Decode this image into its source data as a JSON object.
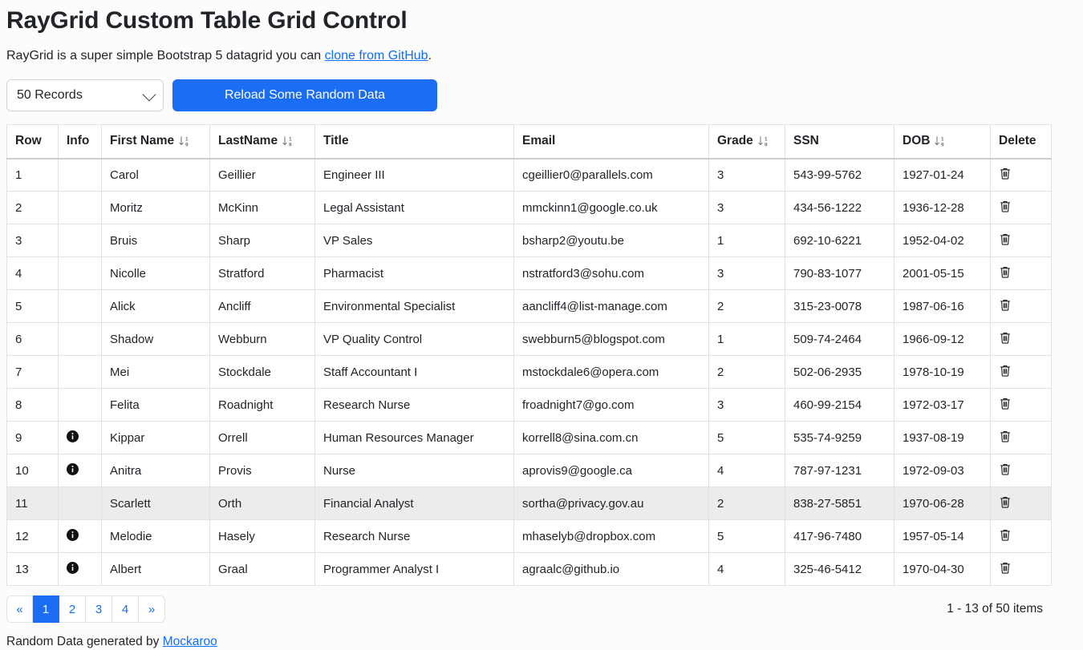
{
  "header": {
    "title": "RayGrid Custom Table Grid Control",
    "lead_prefix": "RayGrid is a super simple Bootstrap 5 datagrid you can ",
    "lead_link": "clone from GitHub",
    "lead_suffix": "."
  },
  "controls": {
    "records_select_value": "50 Records",
    "records_select_options": [
      "50 Records"
    ],
    "chevron_icon": "chevron-down-icon",
    "reload_button_label": "Reload Some Random Data",
    "primary_color": "#1b6ef3"
  },
  "table": {
    "columns": [
      {
        "key": "row",
        "label": "Row",
        "sortable": false
      },
      {
        "key": "info",
        "label": "Info",
        "sortable": false
      },
      {
        "key": "first",
        "label": "First Name",
        "sortable": true
      },
      {
        "key": "last",
        "label": "LastName",
        "sortable": true
      },
      {
        "key": "title",
        "label": "Title",
        "sortable": false
      },
      {
        "key": "email",
        "label": "Email",
        "sortable": false
      },
      {
        "key": "grade",
        "label": "Grade",
        "sortable": true
      },
      {
        "key": "ssn",
        "label": "SSN",
        "sortable": false
      },
      {
        "key": "dob",
        "label": "DOB",
        "sortable": true
      },
      {
        "key": "del",
        "label": "Delete",
        "sortable": false
      }
    ],
    "sort_icon": "sort-numeric-down-icon",
    "info_icon": "info-circle-fill-icon",
    "delete_icon": "trash-icon",
    "hovered_row_index": 10,
    "rows": [
      {
        "row": "1",
        "info": false,
        "first": "Carol",
        "last": "Geillier",
        "title": "Engineer III",
        "email": "cgeillier0@parallels.com",
        "grade": "3",
        "ssn": "543-99-5762",
        "dob": "1927-01-24"
      },
      {
        "row": "2",
        "info": false,
        "first": "Moritz",
        "last": "McKinn",
        "title": "Legal Assistant",
        "email": "mmckinn1@google.co.uk",
        "grade": "3",
        "ssn": "434-56-1222",
        "dob": "1936-12-28"
      },
      {
        "row": "3",
        "info": false,
        "first": "Bruis",
        "last": "Sharp",
        "title": "VP Sales",
        "email": "bsharp2@youtu.be",
        "grade": "1",
        "ssn": "692-10-6221",
        "dob": "1952-04-02"
      },
      {
        "row": "4",
        "info": false,
        "first": "Nicolle",
        "last": "Stratford",
        "title": "Pharmacist",
        "email": "nstratford3@sohu.com",
        "grade": "3",
        "ssn": "790-83-1077",
        "dob": "2001-05-15"
      },
      {
        "row": "5",
        "info": false,
        "first": "Alick",
        "last": "Ancliff",
        "title": "Environmental Specialist",
        "email": "aancliff4@list-manage.com",
        "grade": "2",
        "ssn": "315-23-0078",
        "dob": "1987-06-16"
      },
      {
        "row": "6",
        "info": false,
        "first": "Shadow",
        "last": "Webburn",
        "title": "VP Quality Control",
        "email": "swebburn5@blogspot.com",
        "grade": "1",
        "ssn": "509-74-2464",
        "dob": "1966-09-12"
      },
      {
        "row": "7",
        "info": false,
        "first": "Mei",
        "last": "Stockdale",
        "title": "Staff Accountant I",
        "email": "mstockdale6@opera.com",
        "grade": "2",
        "ssn": "502-06-2935",
        "dob": "1978-10-19"
      },
      {
        "row": "8",
        "info": false,
        "first": "Felita",
        "last": "Roadnight",
        "title": "Research Nurse",
        "email": "froadnight7@go.com",
        "grade": "3",
        "ssn": "460-99-2154",
        "dob": "1972-03-17"
      },
      {
        "row": "9",
        "info": true,
        "first": "Kippar",
        "last": "Orrell",
        "title": "Human Resources Manager",
        "email": "korrell8@sina.com.cn",
        "grade": "5",
        "ssn": "535-74-9259",
        "dob": "1937-08-19"
      },
      {
        "row": "10",
        "info": true,
        "first": "Anitra",
        "last": "Provis",
        "title": "Nurse",
        "email": "aprovis9@google.ca",
        "grade": "4",
        "ssn": "787-97-1231",
        "dob": "1972-09-03"
      },
      {
        "row": "11",
        "info": false,
        "first": "Scarlett",
        "last": "Orth",
        "title": "Financial Analyst",
        "email": "sortha@privacy.gov.au",
        "grade": "2",
        "ssn": "838-27-5851",
        "dob": "1970-06-28"
      },
      {
        "row": "12",
        "info": true,
        "first": "Melodie",
        "last": "Hasely",
        "title": "Research Nurse",
        "email": "mhaselyb@dropbox.com",
        "grade": "5",
        "ssn": "417-96-7480",
        "dob": "1957-05-14"
      },
      {
        "row": "13",
        "info": true,
        "first": "Albert",
        "last": "Graal",
        "title": "Programmer Analyst I",
        "email": "agraalc@github.io",
        "grade": "4",
        "ssn": "325-46-5412",
        "dob": "1970-04-30"
      }
    ]
  },
  "pagination": {
    "items": [
      {
        "label": "«",
        "name": "pagination-prev",
        "active": false
      },
      {
        "label": "1",
        "name": "pagination-page-1",
        "active": true
      },
      {
        "label": "2",
        "name": "pagination-page-2",
        "active": false
      },
      {
        "label": "3",
        "name": "pagination-page-3",
        "active": false
      },
      {
        "label": "4",
        "name": "pagination-page-4",
        "active": false
      },
      {
        "label": "»",
        "name": "pagination-next",
        "active": false
      }
    ],
    "items_count_text": "1 - 13 of 50 items"
  },
  "footer": {
    "credit_prefix": "Random Data generated by ",
    "credit_link": "Mockaroo"
  }
}
